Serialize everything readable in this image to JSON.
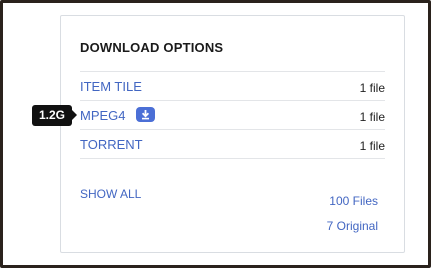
{
  "panel": {
    "title": "DOWNLOAD OPTIONS",
    "rows": [
      {
        "label": "ITEM TILE",
        "count": "1 file"
      },
      {
        "label": "MPEG4",
        "count": "1 file"
      },
      {
        "label": "TORRENT",
        "count": "1 file"
      }
    ],
    "download_icon": "download-icon",
    "tooltip": "1.2G",
    "show_all": "SHOW ALL",
    "total_files": "100 Files",
    "original_files": "7 Original"
  },
  "colors": {
    "link": "#4266c2",
    "download_button": "#4b6fd6",
    "tooltip_bg": "#111111",
    "frame": "#2a221c"
  }
}
